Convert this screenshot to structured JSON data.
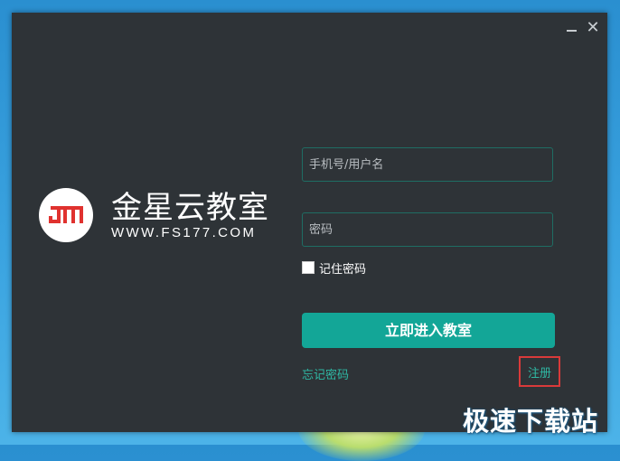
{
  "window": {
    "minimize_glyph": "—",
    "close_glyph": "✕"
  },
  "brand": {
    "title": "金星云教室",
    "url": "WWW.FS177.COM",
    "logo_icon": "jm-logo-icon"
  },
  "login": {
    "username_placeholder": "手机号/用户名",
    "password_placeholder": "密码",
    "remember_label": "记住密码",
    "remember_checked": false,
    "submit_label": "立即进入教室",
    "forgot_label": "忘记密码",
    "register_label": "注册"
  },
  "watermark": {
    "text": "极速下载站"
  },
  "colors": {
    "window_bg": "#2e3337",
    "accent": "#13a697",
    "link": "#2fb8a4",
    "highlight_box": "#d93a3a",
    "logo_red": "#e0322f"
  }
}
